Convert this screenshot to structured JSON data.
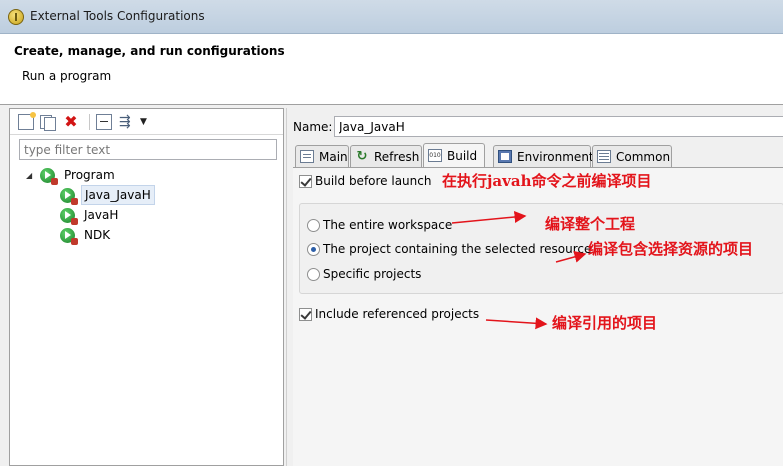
{
  "window": {
    "title": "External Tools Configurations",
    "icon": "external-tools-icon"
  },
  "banner": {
    "title": "Create, manage, and run configurations",
    "subtitle": "Run a program"
  },
  "left": {
    "toolbar": [
      {
        "icon": "new-config-icon"
      },
      {
        "icon": "duplicate-icon"
      },
      {
        "icon": "delete-icon"
      },
      {
        "icon": "collapse-all-icon"
      },
      {
        "icon": "filter-icon"
      },
      {
        "icon": "dropdown-arrow-icon"
      }
    ],
    "filter_placeholder": "type filter text",
    "tree": {
      "root": "Program",
      "children": [
        "Java_JavaH",
        "JavaH",
        "NDK"
      ],
      "selected": "Java_JavaH"
    }
  },
  "right": {
    "name_label": "Name:",
    "name_value": "Java_JavaH",
    "tabs": [
      {
        "label": "Main",
        "icon": "main-tab-icon"
      },
      {
        "label": "Refresh",
        "icon": "refresh-icon"
      },
      {
        "label": "Build",
        "icon": "build-icon",
        "active": true
      },
      {
        "label": "Environment",
        "icon": "environment-icon"
      },
      {
        "label": "Common",
        "icon": "common-icon"
      }
    ],
    "build_before_launch": {
      "label": "Build before launch",
      "checked": true
    },
    "scope_options": [
      {
        "label": "The entire workspace",
        "checked": false
      },
      {
        "label": "The project containing the selected resource",
        "checked": true
      },
      {
        "label": "Specific projects",
        "checked": false
      }
    ],
    "include_referenced": {
      "label": "Include referenced projects",
      "checked": true
    }
  },
  "annotations": {
    "build_before": "在执行javah命令之前编译项目",
    "workspace": "编译整个工程",
    "containing": "编译包含选择资源的项目",
    "referenced": "编译引用的项目",
    "color": "#e3141b"
  },
  "colors": {
    "titlebar": "#c4d4e4",
    "selection": "#e6eef8",
    "run_icon": "#2a9a3a"
  }
}
